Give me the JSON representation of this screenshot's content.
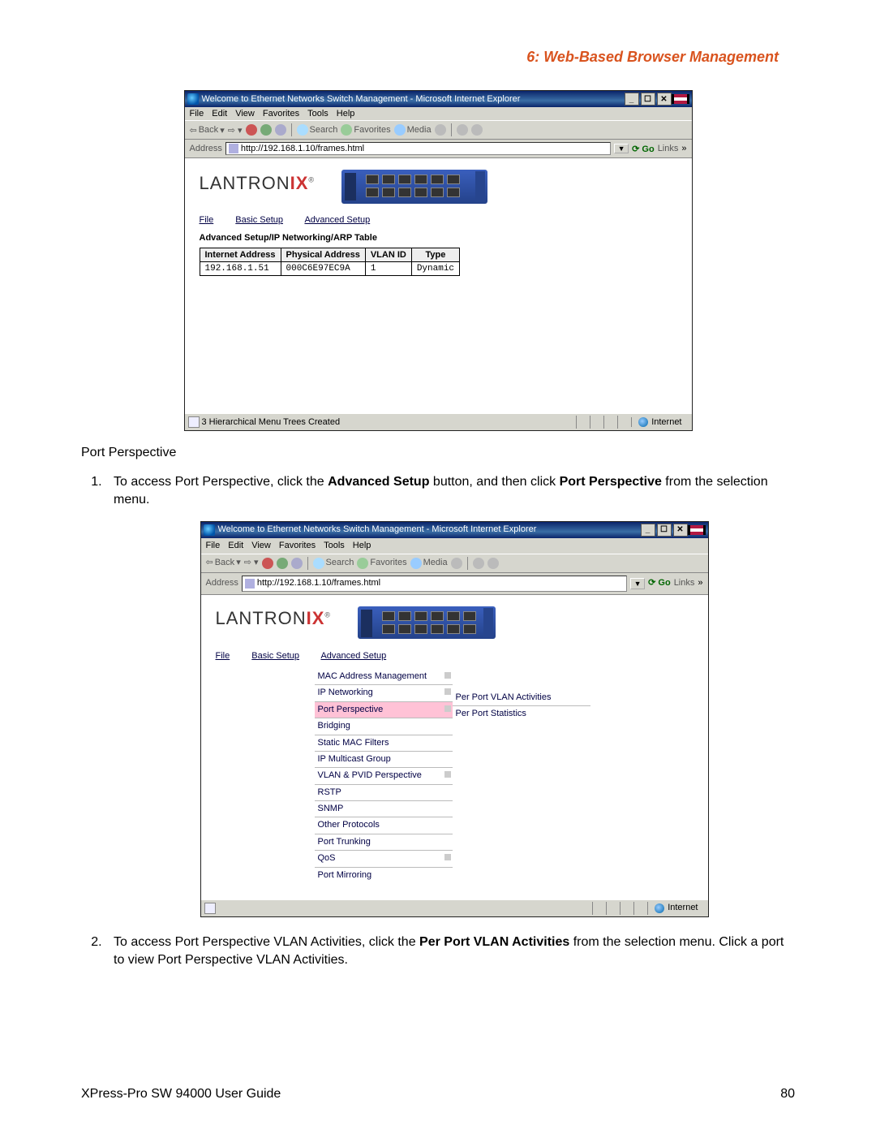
{
  "chapter_heading": "6: Web-Based Browser Management",
  "section_heading": "Port Perspective",
  "step1_pre": "To access Port Perspective, click the ",
  "step1_b1": "Advanced Setup",
  "step1_mid": " button, and then click ",
  "step1_b2": "Port Perspective",
  "step1_post": " from the selection menu.",
  "step2_pre": "To access Port Perspective VLAN Activities, click the ",
  "step2_b1": "Per Port VLAN Activities",
  "step2_post": " from the selection menu. Click a port to view Port Perspective VLAN Activities.",
  "footer_left": "XPress-Pro SW 94000 User Guide",
  "footer_page": "80",
  "brand": {
    "name": "LANTRON",
    "suffix": "IX",
    "reg": "®"
  },
  "ie_common": {
    "title": "Welcome to Ethernet Networks Switch Management - Microsoft Internet Explorer",
    "menus": [
      "File",
      "Edit",
      "View",
      "Favorites",
      "Tools",
      "Help"
    ],
    "back": "Back",
    "search": "Search",
    "favorites": "Favorites",
    "media": "Media",
    "address_label": "Address",
    "url": "http://192.168.1.10/frames.html",
    "go": "Go",
    "links": "Links",
    "internet": "Internet"
  },
  "nav": {
    "file": "File",
    "basic": "Basic Setup",
    "advanced": "Advanced Setup"
  },
  "shot1": {
    "status": "3 Hierarchical Menu Trees Created",
    "breadcrumb": "Advanced Setup/IP Networking/ARP Table",
    "arp_headers": [
      "Internet Address",
      "Physical Address",
      "VLAN ID",
      "Type"
    ],
    "arp_row": [
      "192.168.1.51",
      "000C6E97EC9A",
      "1",
      "Dynamic"
    ]
  },
  "shot2": {
    "status": "",
    "menu_items": [
      "MAC Address Management",
      "IP Networking",
      "Port Perspective",
      "Bridging",
      "Static MAC Filters",
      "IP Multicast Group",
      "VLAN & PVID Perspective",
      "RSTP",
      "SNMP",
      "Other Protocols",
      "Port Trunking",
      "QoS",
      "Port Mirroring"
    ],
    "submenu_items": [
      "Per Port VLAN Activities",
      "Per Port Statistics"
    ]
  }
}
